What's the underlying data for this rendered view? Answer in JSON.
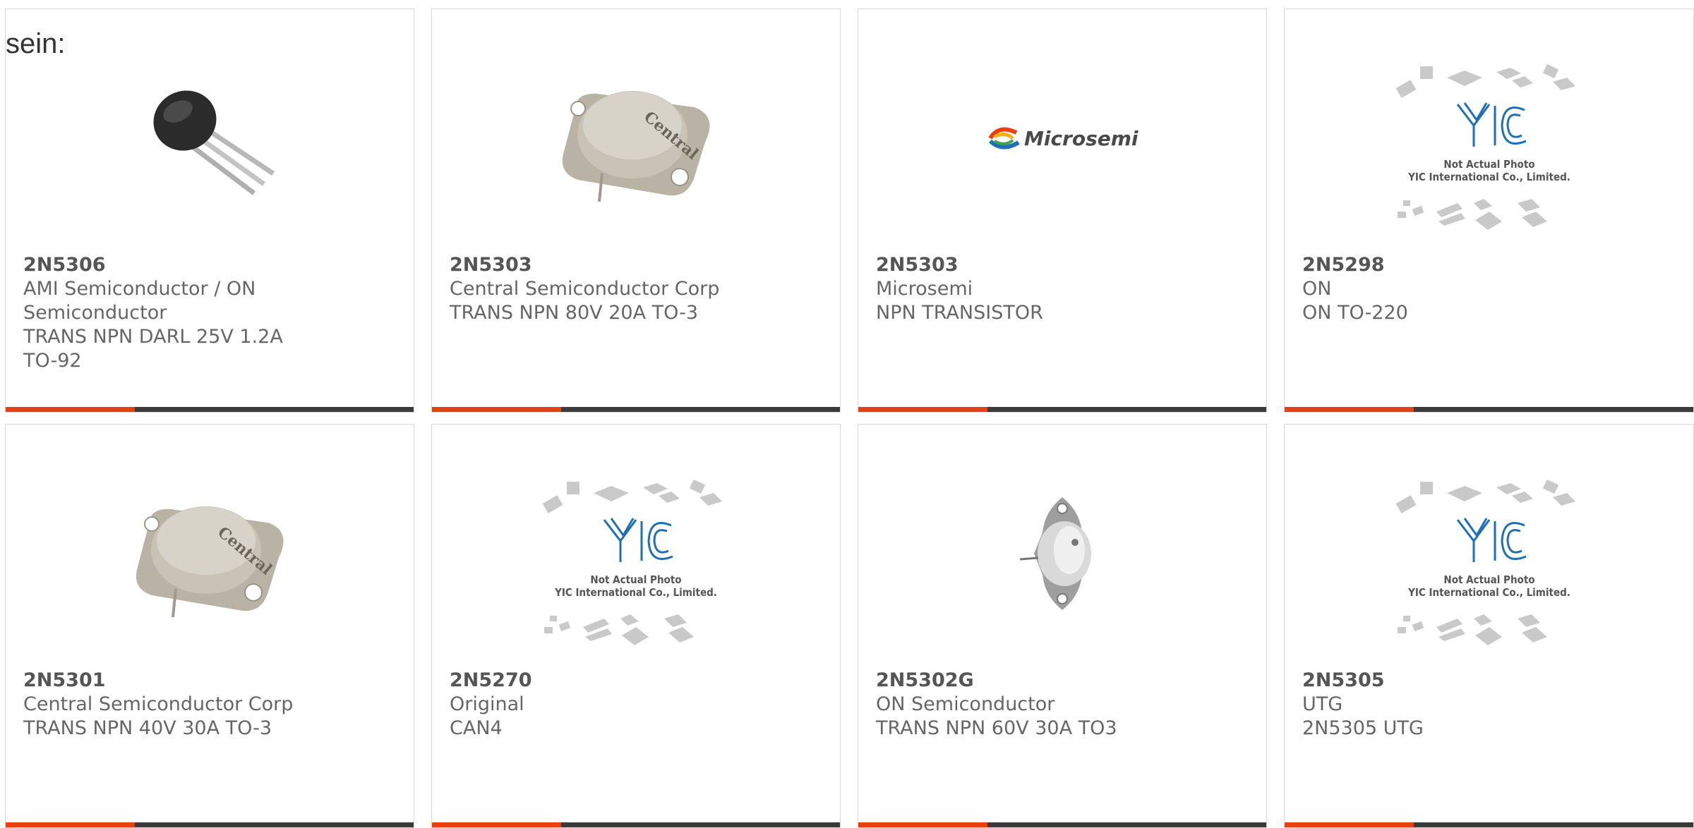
{
  "lead_text": "sein:",
  "accent_color": "#e8410f",
  "bar_color": "#3a3a3a",
  "products": [
    {
      "part": "2N5306",
      "maker": "AMI Semiconductor / ON Semiconductor",
      "desc": "TRANS NPN DARL 25V 1.2A TO-92",
      "image": "to92-transistor-photo"
    },
    {
      "part": "2N5303",
      "maker": "Central Semiconductor Corp",
      "desc": "TRANS NPN 80V 20A TO-3",
      "image": "to3-central-photo",
      "image_text": "Central"
    },
    {
      "part": "2N5303",
      "maker": "Microsemi",
      "desc": "NPN TRANSISTOR",
      "image": "microsemi-logo",
      "image_text": "Microsemi"
    },
    {
      "part": "2N5298",
      "maker": "ON",
      "desc": "ON TO-220",
      "image": "yic-placeholder",
      "image_text": [
        "Not Actual Photo",
        "YIC International Co., Limited."
      ]
    },
    {
      "part": "2N5301",
      "maker": "Central Semiconductor Corp",
      "desc": "TRANS NPN 40V 30A TO-3",
      "image": "to3-central-photo",
      "image_text": "Central"
    },
    {
      "part": "2N5270",
      "maker": "Original",
      "desc": "CAN4",
      "image": "yic-placeholder",
      "image_text": [
        "Not Actual Photo",
        "YIC International Co., Limited."
      ]
    },
    {
      "part": "2N5302G",
      "maker": "ON Semiconductor",
      "desc": "TRANS NPN 60V 30A TO3",
      "image": "to3-on-photo"
    },
    {
      "part": "2N5305",
      "maker": "UTG",
      "desc": "2N5305 UTG",
      "image": "yic-placeholder",
      "image_text": [
        "Not Actual Photo",
        "YIC International Co., Limited."
      ]
    }
  ]
}
